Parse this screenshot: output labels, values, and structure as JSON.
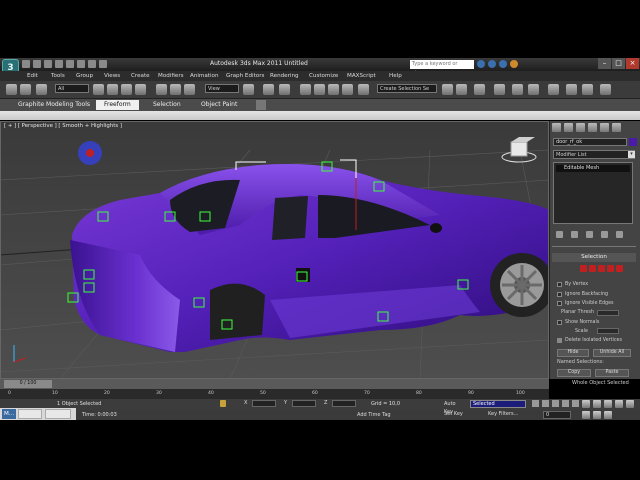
{
  "window": {
    "title": "Autodesk 3ds Max 2011     Untitled",
    "search_placeholder": "Type a keyword or phrase",
    "logo_text": "3"
  },
  "menu": [
    "Edit",
    "Tools",
    "Group",
    "Views",
    "Create",
    "Modifiers",
    "Animation",
    "Graph Editors",
    "Rendering",
    "Customize",
    "MAXScript",
    "Help"
  ],
  "toolbar": {
    "filter": "All",
    "coord": "View",
    "named_selection": "Create Selection Se"
  },
  "ribbon": {
    "tabs": [
      "Graphite Modeling Tools",
      "Freeform",
      "Selection",
      "Object Paint"
    ]
  },
  "viewport": {
    "label": "[ + ] [ Perspective ] [ Smooth + Highlights ]"
  },
  "command_panel": {
    "object_name": "door_rf_ok",
    "object_color": "#4a1aa8",
    "modifier_list": "Modifier List",
    "stack_item": "Editable Mesh",
    "selection_title": "Selection",
    "by_vertex": "By Vertex",
    "ignore_backfacing": "Ignore Backfacing",
    "ignore_visible_edges": "Ignore Visible Edges",
    "planar_thresh": "Planar Thresh",
    "show_normals": "Show Normals",
    "scale": "Scale",
    "delete_isolated": "Delete Isolated Vertices",
    "hide": "Hide",
    "unhide_all": "Unhide All",
    "named_selections": "Named Selections:",
    "copy": "Copy",
    "paste": "Paste",
    "whole_object": "Whole Object Selected"
  },
  "timeline": {
    "slider": "0 / 100",
    "ticks": [
      "0",
      "10",
      "20",
      "30",
      "40",
      "50",
      "60",
      "70",
      "80",
      "90",
      "100"
    ]
  },
  "status": {
    "objects_selected": "1 Object Selected",
    "x_label": "X",
    "y_label": "Y",
    "z_label": "Z",
    "grid": "Grid = 10,0",
    "time_label": "Time: 0:00:03",
    "add_time_tag": "Add Time Tag",
    "auto_key": "Auto Key",
    "set_key": "Set Key",
    "key_mode": "Selected",
    "key_filters": "Key Filters...",
    "frame": "0"
  },
  "taskbar": {
    "item": "M..."
  }
}
